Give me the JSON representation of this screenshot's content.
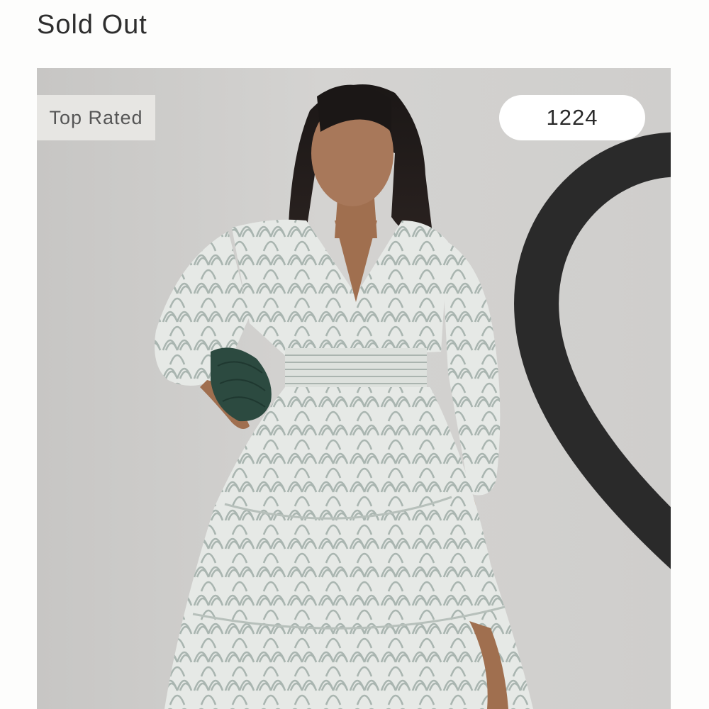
{
  "product": {
    "status_label": "Sold Out",
    "badge_label": "Top Rated",
    "likes_count": "1224",
    "like_icon": "heart-outline-icon",
    "image_subject": "model-in-printed-tiered-midi-dress"
  },
  "colors": {
    "background": "#fdfdfc",
    "image_backdrop": "#cfcecc",
    "text_primary": "#2e2e2e",
    "badge_bg": "#e9e8e5",
    "likes_bg": "#ffffff",
    "dress_base": "#dfe3e0",
    "dress_pattern": "#a9b5b0",
    "clutch": "#2c4a40"
  }
}
